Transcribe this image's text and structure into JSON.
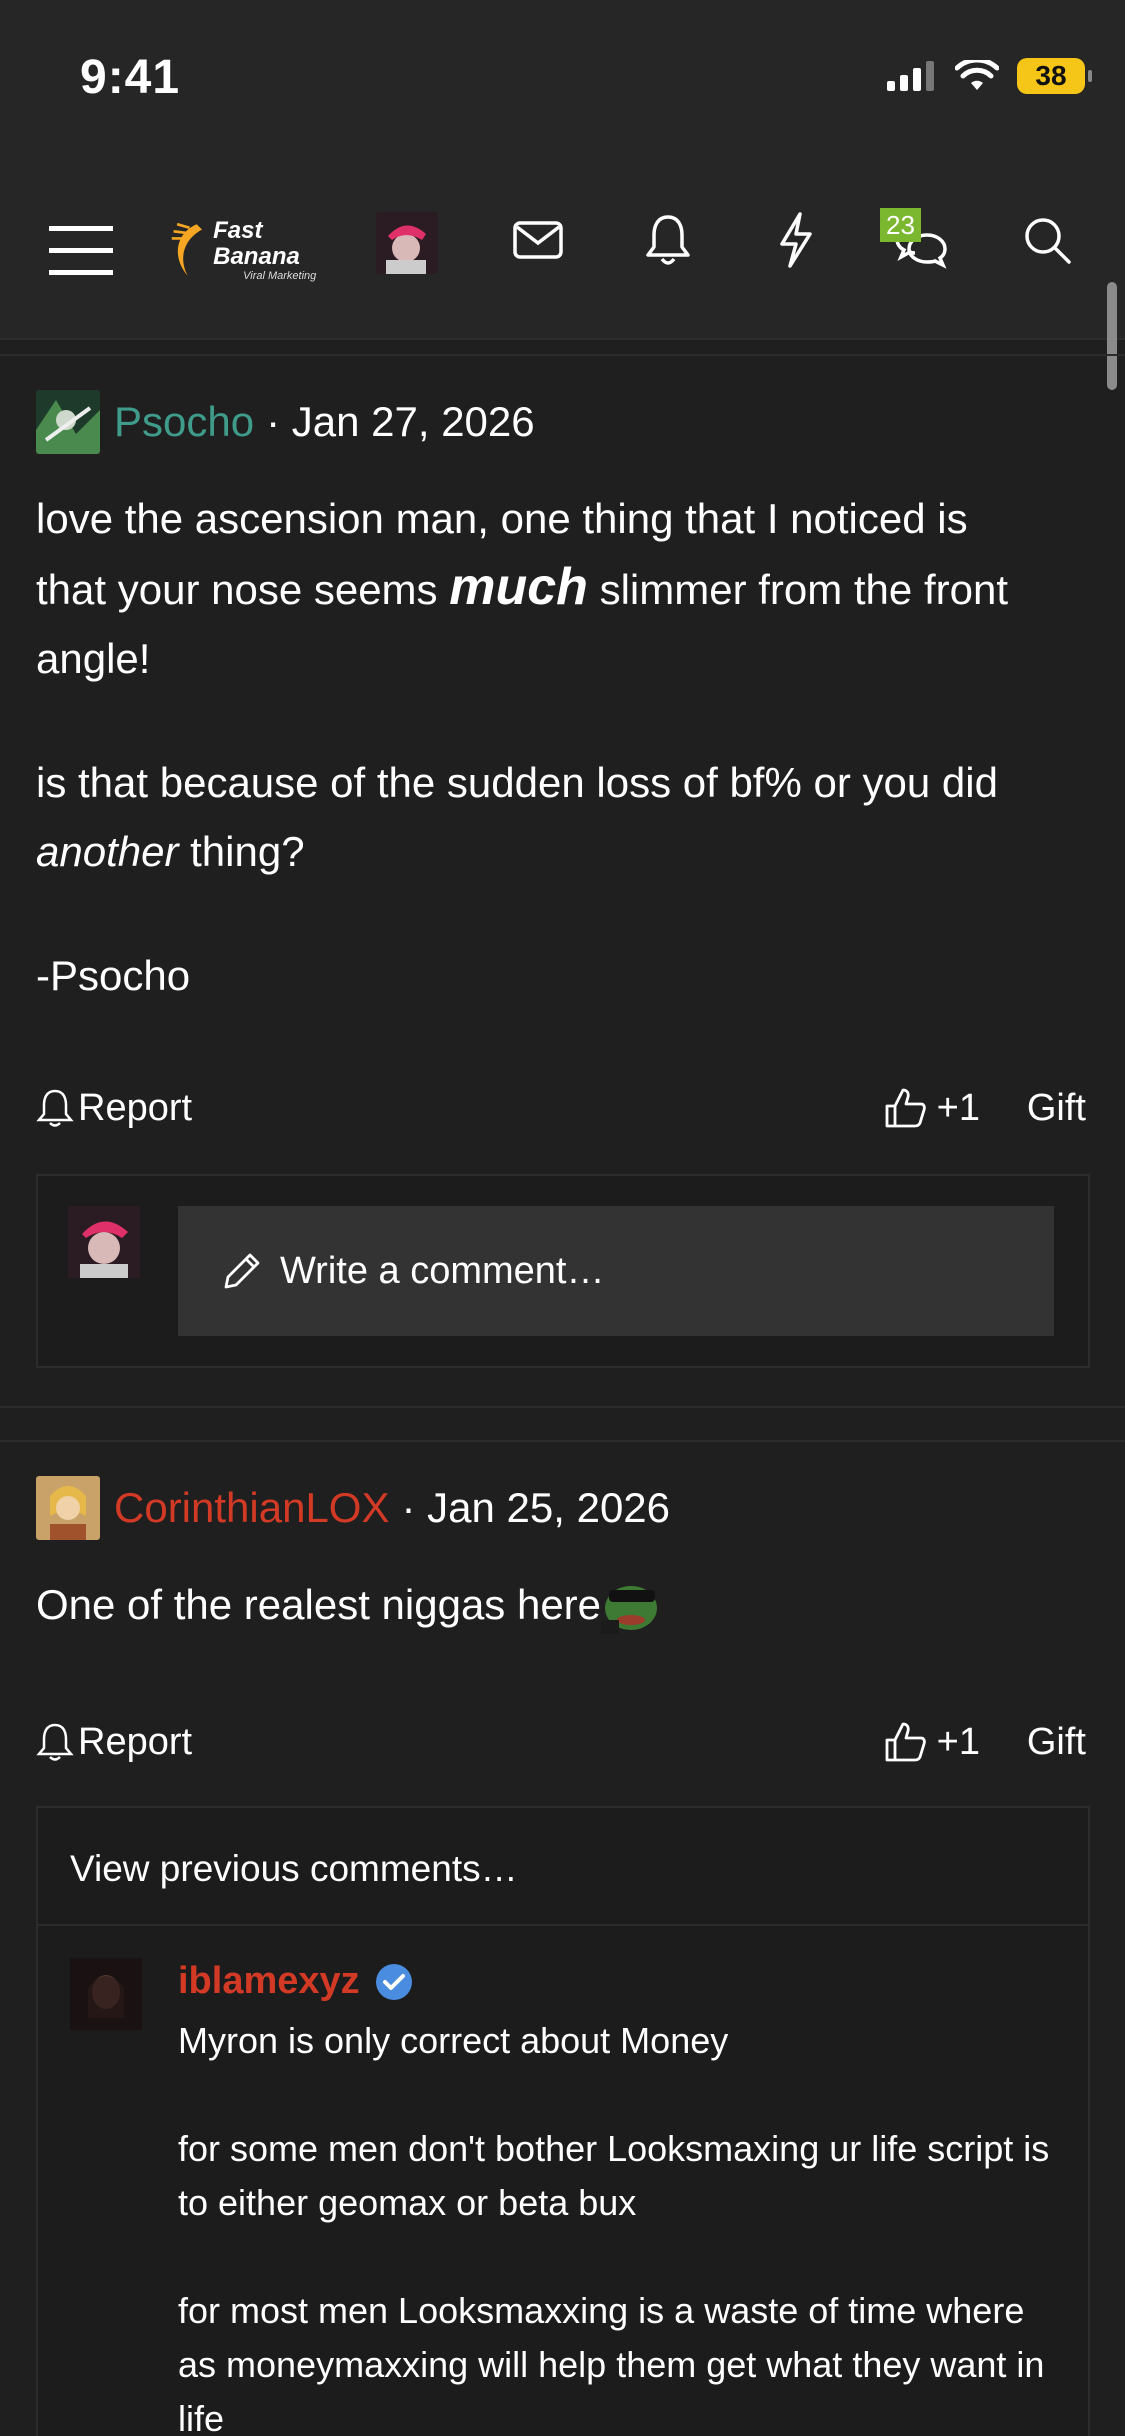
{
  "status": {
    "time": "9:41",
    "battery": "38"
  },
  "nav": {
    "logo_title": "Fast Banana",
    "logo_sub": "Viral Marketing",
    "chat_badge": "23"
  },
  "posts": [
    {
      "username": "Psocho",
      "date": "· Jan 27, 2026",
      "body_l1": "love the ascension man, one thing that I noticed is",
      "body_l2a": "that your nose seems ",
      "body_l2b": "much",
      "body_l2c": " slimmer from the front",
      "body_l3": "angle!",
      "body_l4": "is that because of the sudden loss of bf% or you did",
      "body_l5a": "another",
      "body_l5b": " thing?",
      "body_l6": "-Psocho",
      "report": "Report",
      "like": "+1",
      "gift": "Gift",
      "comment_placeholder": "Write a comment…"
    },
    {
      "username": "CorinthianLOX",
      "date": "· Jan 25, 2026",
      "body": "One of the realest niggas here",
      "report": "Report",
      "like": "+1",
      "gift": "Gift"
    }
  ],
  "comments": {
    "view_previous": "View previous comments…",
    "reply": {
      "username": "iblamexyz",
      "p1": "Myron is only correct about Money",
      "p2": "for some men don't bother Looksmaxing ur life script is to either geomax or beta bux",
      "p3": "for most men Looksmaxxing is a waste of time where as moneymaxxing will help them get what they want in life"
    }
  },
  "colors": {
    "background": "#1f1f1f",
    "teal_user": "#3f9b8a",
    "red_user": "#d33a25",
    "badge": "#7cb82f"
  }
}
